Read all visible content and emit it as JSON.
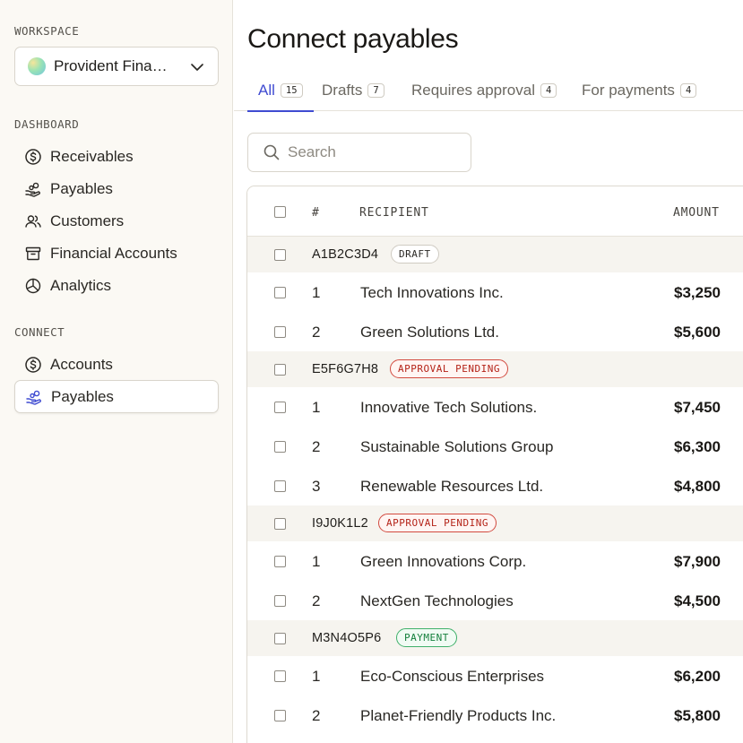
{
  "sidebar": {
    "workspace_label": "WORKSPACE",
    "workspace_name": "Provident Financial",
    "dashboard_label": "DASHBOARD",
    "dashboard_items": [
      {
        "label": "Receivables",
        "icon": "dollar-circle-icon"
      },
      {
        "label": "Payables",
        "icon": "hand-coins-icon"
      },
      {
        "label": "Customers",
        "icon": "users-icon"
      },
      {
        "label": "Financial Accounts",
        "icon": "archive-box-icon"
      },
      {
        "label": "Analytics",
        "icon": "pie-chart-icon"
      }
    ],
    "connect_label": "CONNECT",
    "connect_items": [
      {
        "label": "Accounts",
        "icon": "dollar-circle-icon"
      },
      {
        "label": "Payables",
        "icon": "hand-coins-icon",
        "active": true
      }
    ]
  },
  "main": {
    "title": "Connect payables",
    "tabs": [
      {
        "label": "All",
        "count": "15",
        "active": true
      },
      {
        "label": "Drafts",
        "count": "7"
      },
      {
        "label": "Requires approval",
        "count": "4"
      },
      {
        "label": "For payments",
        "count": "4"
      }
    ],
    "search_placeholder": "Search",
    "table": {
      "headers": {
        "index": "#",
        "recipient": "RECIPIENT",
        "amount": "AMOUNT"
      },
      "groups": [
        {
          "id": "A1B2C3D4",
          "status": "DRAFT",
          "status_type": "draft",
          "items": [
            {
              "n": "1",
              "recipient": "Tech Innovations Inc.",
              "amount": "$3,250"
            },
            {
              "n": "2",
              "recipient": "Green Solutions Ltd.",
              "amount": "$5,600"
            }
          ]
        },
        {
          "id": "E5F6G7H8",
          "status": "APPROVAL PENDING",
          "status_type": "pending",
          "items": [
            {
              "n": "1",
              "recipient": "Innovative Tech Solutions.",
              "amount": "$7,450"
            },
            {
              "n": "2",
              "recipient": "Sustainable Solutions Group",
              "amount": "$6,300"
            },
            {
              "n": "3",
              "recipient": "Renewable Resources Ltd.",
              "amount": "$4,800"
            }
          ]
        },
        {
          "id": "I9J0K1L2",
          "status": "APPROVAL PENDING",
          "status_type": "pending",
          "items": [
            {
              "n": "1",
              "recipient": "Green Innovations Corp.",
              "amount": "$7,900"
            },
            {
              "n": "2",
              "recipient": "NextGen Technologies",
              "amount": "$4,500"
            }
          ]
        },
        {
          "id": "M3N4O5P6",
          "status": "PAYMENT",
          "status_type": "payment",
          "items": [
            {
              "n": "1",
              "recipient": "Eco-Conscious Enterprises",
              "amount": "$6,200"
            },
            {
              "n": "2",
              "recipient": "Planet-Friendly Products Inc.",
              "amount": "$5,800"
            }
          ]
        }
      ]
    }
  },
  "colors": {
    "accent": "#3f4bd1",
    "sidebar_bg": "#fbf9f4",
    "pending": "#b42318",
    "payment": "#15803d"
  }
}
